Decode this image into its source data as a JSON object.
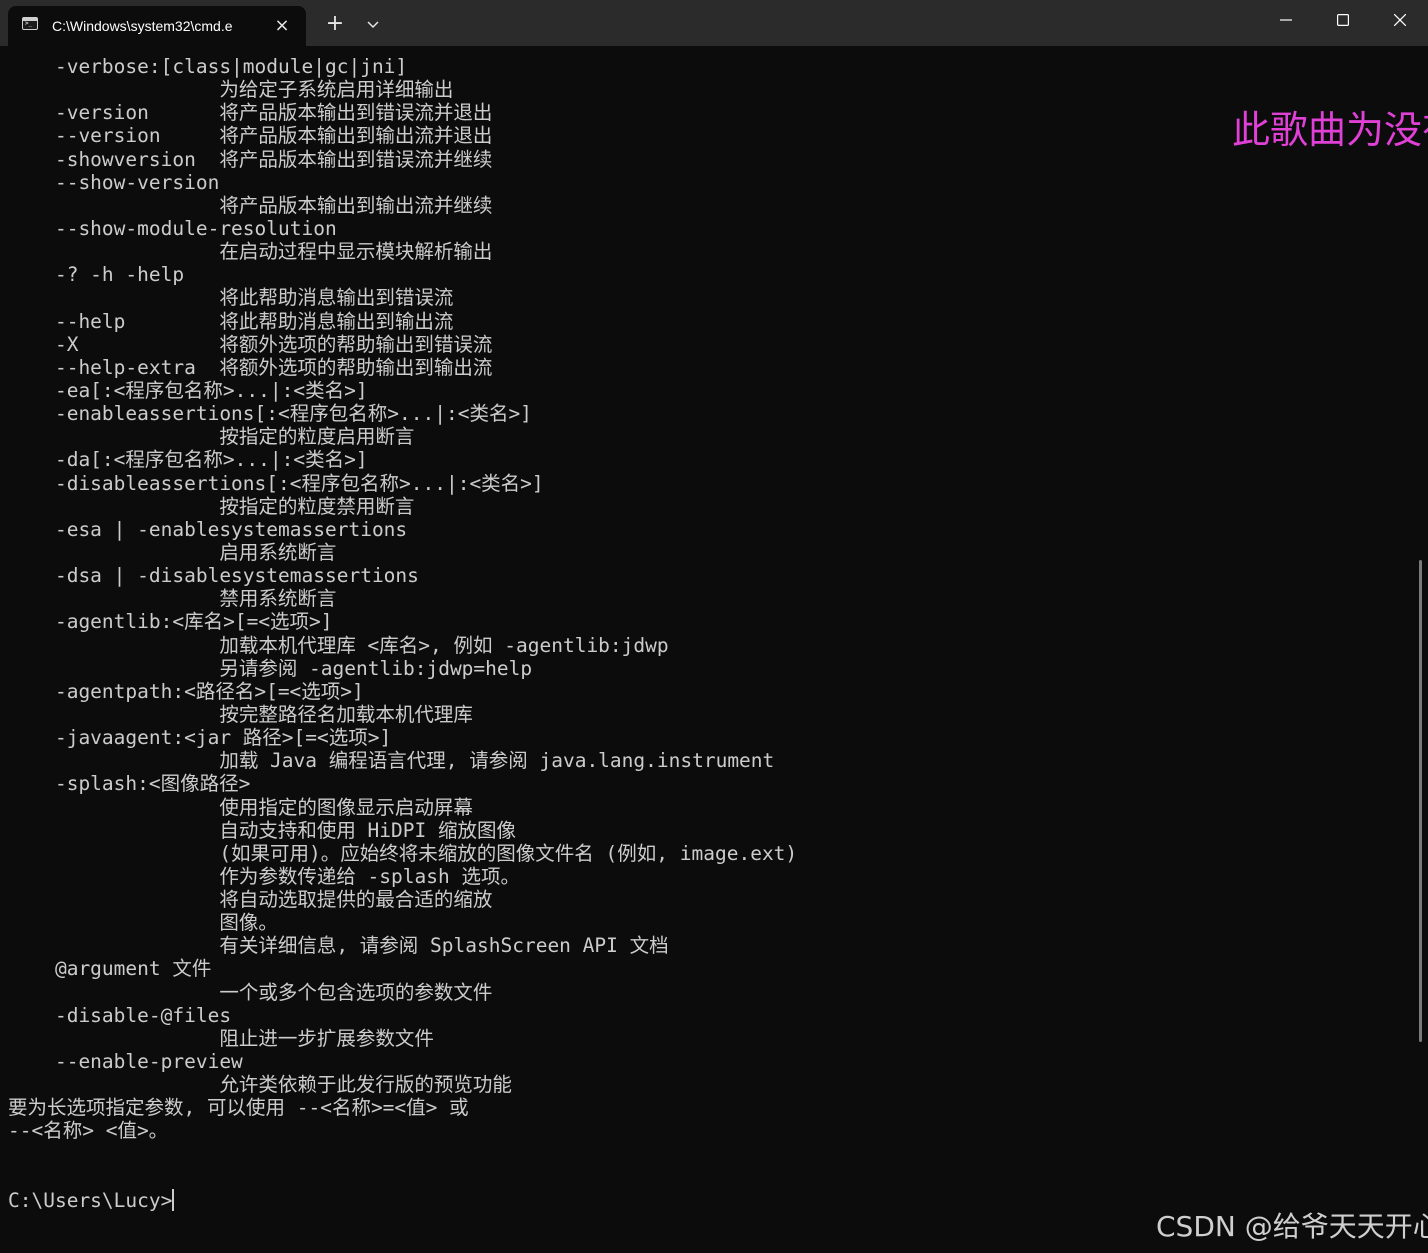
{
  "window": {
    "tab_title": "C:\\Windows\\system32\\cmd.e",
    "tab_icon": "terminal-icon",
    "close_tab_icon": "×",
    "new_tab_icon": "+",
    "controls": [
      "minimize-icon",
      "maximize-icon",
      "close-icon"
    ]
  },
  "console": {
    "lines": [
      "    -verbose:[class|module|gc|jni]",
      "                  为给定子系统启用详细输出",
      "    -version      将产品版本输出到错误流并退出",
      "    --version     将产品版本输出到输出流并退出",
      "    -showversion  将产品版本输出到错误流并继续",
      "    --show-version",
      "                  将产品版本输出到输出流并继续",
      "    --show-module-resolution",
      "                  在启动过程中显示模块解析输出",
      "    -? -h -help",
      "                  将此帮助消息输出到错误流",
      "    --help        将此帮助消息输出到输出流",
      "    -X            将额外选项的帮助输出到错误流",
      "    --help-extra  将额外选项的帮助输出到输出流",
      "    -ea[:<程序包名称>...|:<类名>]",
      "    -enableassertions[:<程序包名称>...|:<类名>]",
      "                  按指定的粒度启用断言",
      "    -da[:<程序包名称>...|:<类名>]",
      "    -disableassertions[:<程序包名称>...|:<类名>]",
      "                  按指定的粒度禁用断言",
      "    -esa | -enablesystemassertions",
      "                  启用系统断言",
      "    -dsa | -disablesystemassertions",
      "                  禁用系统断言",
      "    -agentlib:<库名>[=<选项>]",
      "                  加载本机代理库 <库名>, 例如 -agentlib:jdwp",
      "                  另请参阅 -agentlib:jdwp=help",
      "    -agentpath:<路径名>[=<选项>]",
      "                  按完整路径名加载本机代理库",
      "    -javaagent:<jar 路径>[=<选项>]",
      "                  加载 Java 编程语言代理, 请参阅 java.lang.instrument",
      "    -splash:<图像路径>",
      "                  使用指定的图像显示启动屏幕",
      "                  自动支持和使用 HiDPI 缩放图像",
      "                  (如果可用)。应始终将未缩放的图像文件名 (例如, image.ext)",
      "                  作为参数传递给 -splash 选项。",
      "                  将自动选取提供的最合适的缩放",
      "                  图像。",
      "                  有关详细信息, 请参阅 SplashScreen API 文档",
      "    @argument 文件",
      "                  一个或多个包含选项的参数文件",
      "    -disable-@files",
      "                  阻止进一步扩展参数文件",
      "    --enable-preview",
      "                  允许类依赖于此发行版的预览功能",
      "要为长选项指定参数, 可以使用 --<名称>=<值> 或",
      "--<名称> <值>。",
      "",
      ""
    ],
    "prompt": "C:\\Users\\Lucy>"
  },
  "overlay": {
    "song_text": "此歌曲为没有",
    "watermark": "CSDN @给爷天天开心"
  },
  "colors": {
    "background": "#0c0c0c",
    "titlebar": "#2b2b2b",
    "text": "#cccccc",
    "song_overlay": "#e040d6"
  }
}
